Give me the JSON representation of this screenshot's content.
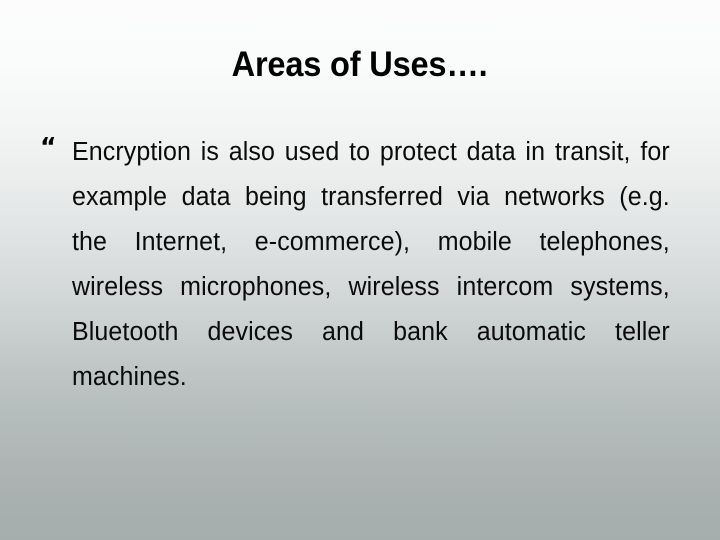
{
  "slide": {
    "title": "Areas of Uses….",
    "background": {
      "top_color": "#fcfcfc",
      "bottom_color": "#a5adad",
      "direction": "vertical"
    },
    "bullets": [
      {
        "marker": "“",
        "marker_name": "wingdings-bullet",
        "text": "Encryption is also used to protect data in transit, for example data being transferred via networks (e.g. the Internet, e-commerce), mobile telephones, wireless microphones, wireless intercom systems, Bluetooth devices and bank automatic teller machines.",
        "lines": [
          "Encryption is also used to protect data in",
          "transit, for example data being transferred via",
          "networks (e.g. the Internet, e-commerce),",
          "mobile telephones, wireless microphones,",
          "wireless intercom systems, Bluetooth devices",
          "and bank automatic teller machines."
        ]
      }
    ],
    "text_color": "#0b0b0b",
    "title_color": "#000000"
  }
}
